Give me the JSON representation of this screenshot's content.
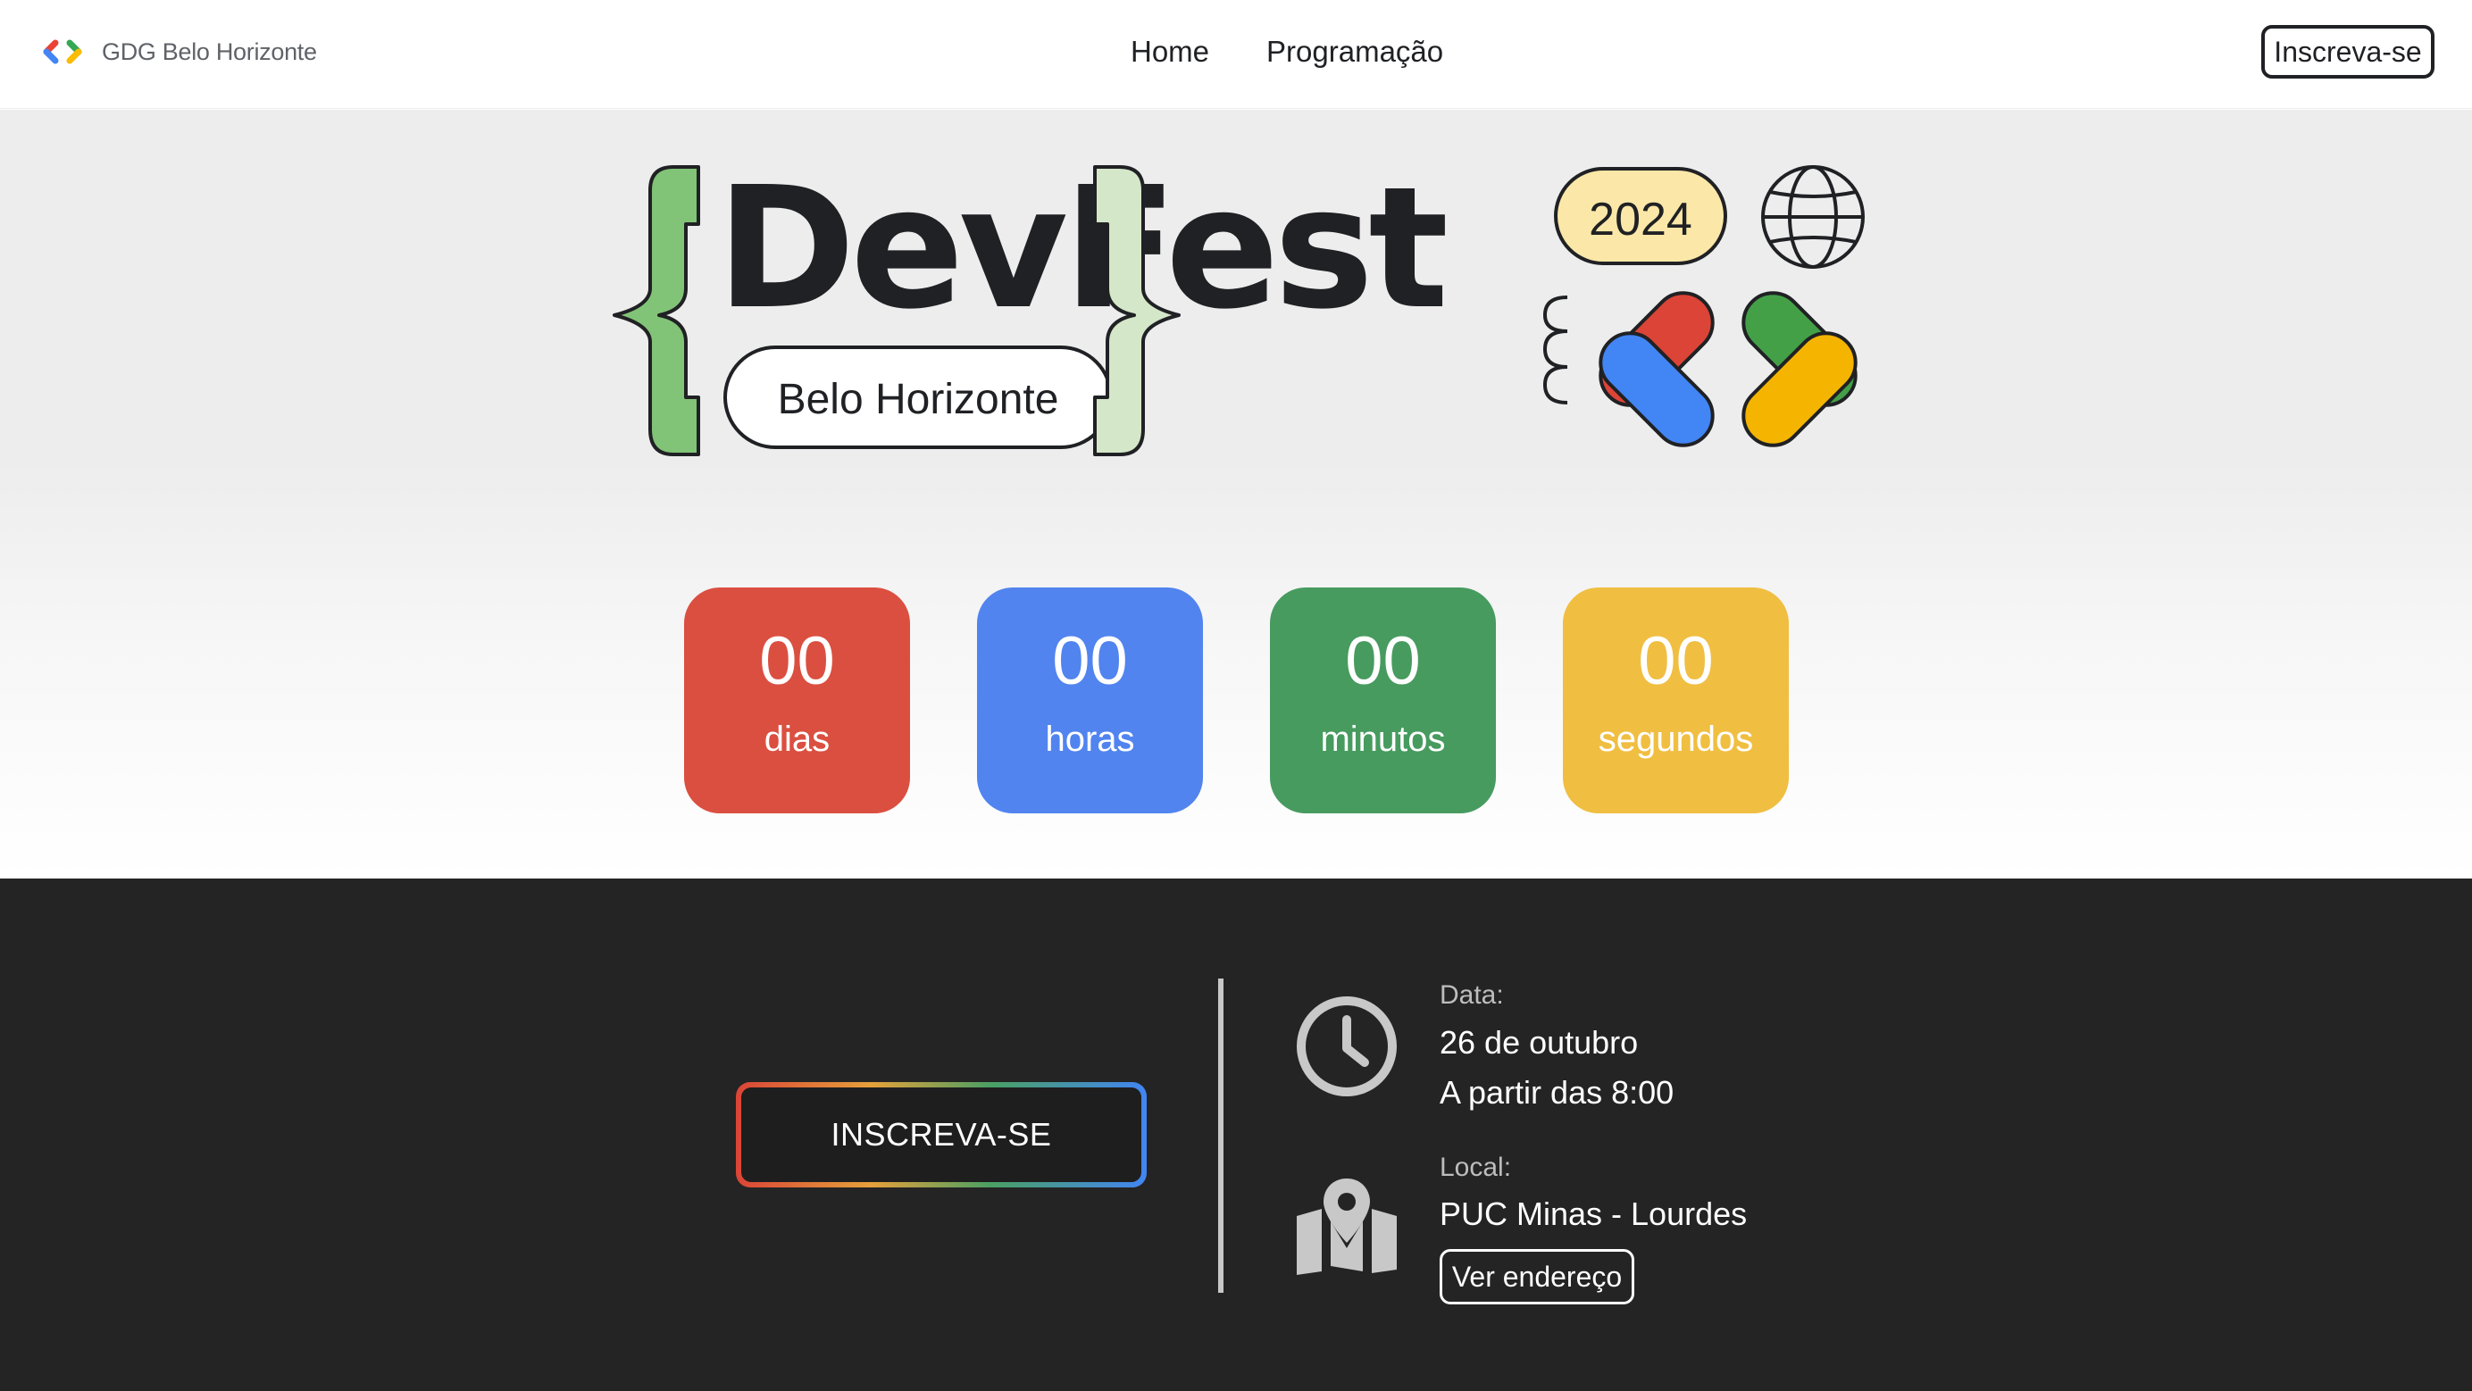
{
  "navbar": {
    "brand": "GDG Belo Horizonte",
    "links": [
      "Home",
      "Programação"
    ],
    "cta": "Inscreva-se"
  },
  "banner": {
    "title": "DevFest",
    "city": "Belo Horizonte",
    "year": "2024"
  },
  "countdown": [
    {
      "value": "00",
      "label": "dias",
      "color": "#db4f40"
    },
    {
      "value": "00",
      "label": "horas",
      "color": "#5184ef"
    },
    {
      "value": "00",
      "label": "minutos",
      "color": "#479b5f"
    },
    {
      "value": "00",
      "label": "segundos",
      "color": "#f0be41"
    }
  ],
  "event": {
    "cta": "INSCREVA-SE",
    "date_label": "Data:",
    "date": "26 de outubro",
    "time": "A partir das 8:00",
    "location_label": "Local:",
    "location": "PUC Minas - Lourdes",
    "address_button": "Ver endereço"
  },
  "colors": {
    "google_red": "#db4437",
    "google_blue": "#4285f4",
    "google_green": "#34a853",
    "google_yellow": "#f4b400",
    "dark_bg": "#242424"
  },
  "icons": [
    "gdg-logo-icon",
    "globe-icon",
    "clock-icon",
    "map-pin-icon"
  ]
}
